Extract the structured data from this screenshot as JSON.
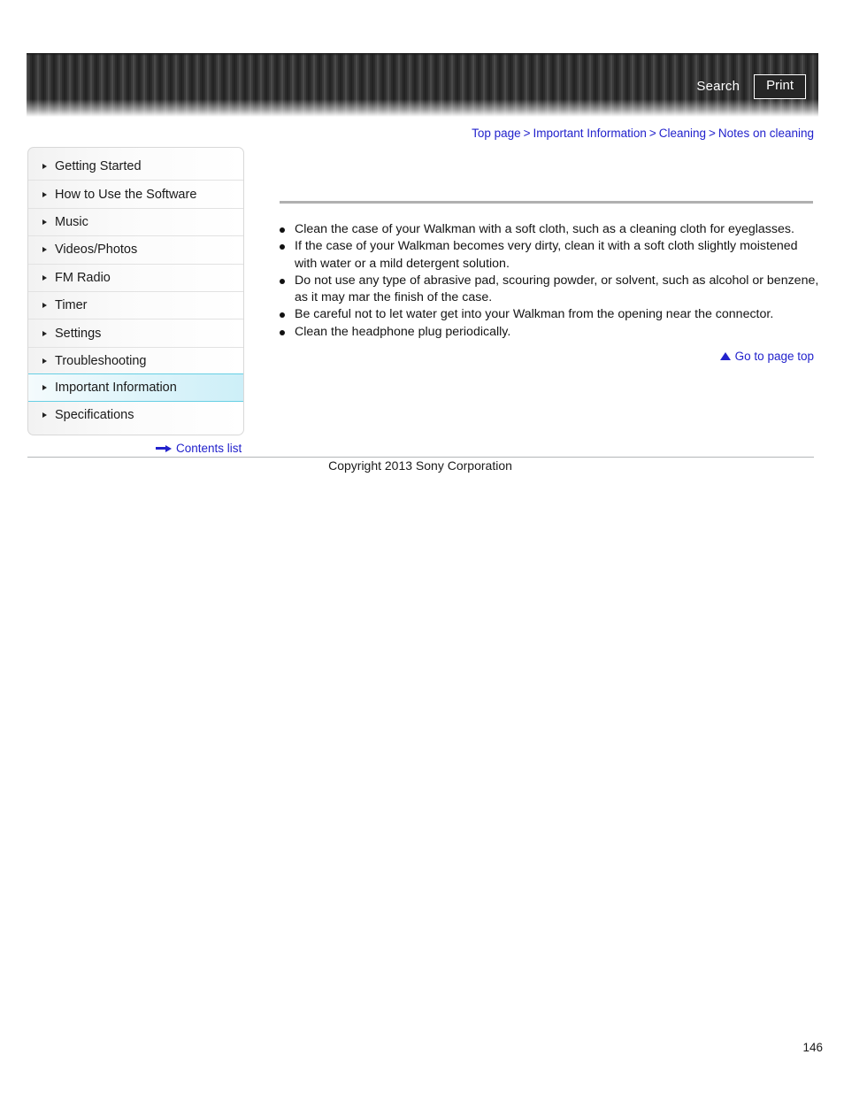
{
  "header": {
    "search_label": "Search",
    "print_label": "Print",
    "search_icon": "search-icon",
    "print_icon": "print-icon"
  },
  "breadcrumb": {
    "separator": ">",
    "items": [
      {
        "label": "Top page"
      },
      {
        "label": "Important Information"
      },
      {
        "label": "Cleaning"
      },
      {
        "label": "Notes on cleaning"
      }
    ]
  },
  "sidebar": {
    "marker_icon": "triangle-right-icon",
    "items": [
      {
        "label": "Getting Started",
        "active": false
      },
      {
        "label": "How to Use the Software",
        "active": false
      },
      {
        "label": "Music",
        "active": false
      },
      {
        "label": "Videos/Photos",
        "active": false
      },
      {
        "label": "FM Radio",
        "active": false
      },
      {
        "label": "Timer",
        "active": false
      },
      {
        "label": "Settings",
        "active": false
      },
      {
        "label": "Troubleshooting",
        "active": false
      },
      {
        "label": "Important Information",
        "active": true
      },
      {
        "label": "Specifications",
        "active": false
      }
    ],
    "active_highlight_color": "#cdeff8",
    "active_border_color": "#67cfe4"
  },
  "contents_list": {
    "label": "Contents list",
    "icon": "arrow-right-icon"
  },
  "main": {
    "bullets": [
      "Clean the case of your Walkman with a soft cloth, such as a cleaning cloth for eyeglasses.",
      "If the case of your Walkman becomes very dirty, clean it with a soft cloth slightly moistened with water or a mild detergent solution.",
      "Do not use any type of abrasive pad, scouring powder, or solvent, such as alcohol or benzene, as it may mar the finish of the case.",
      "Be careful not to let water get into your Walkman from the opening near the connector.",
      "Clean the headphone plug periodically."
    ],
    "go_to_page_top": {
      "label": "Go to page top",
      "icon": "triangle-up-icon"
    }
  },
  "footer": {
    "copyright": "Copyright 2013 Sony Corporation",
    "page_number": "146"
  },
  "colors": {
    "link": "#2222cc",
    "header_dark": "#2b2b2b",
    "rule_gray": "#b0b0b0"
  }
}
